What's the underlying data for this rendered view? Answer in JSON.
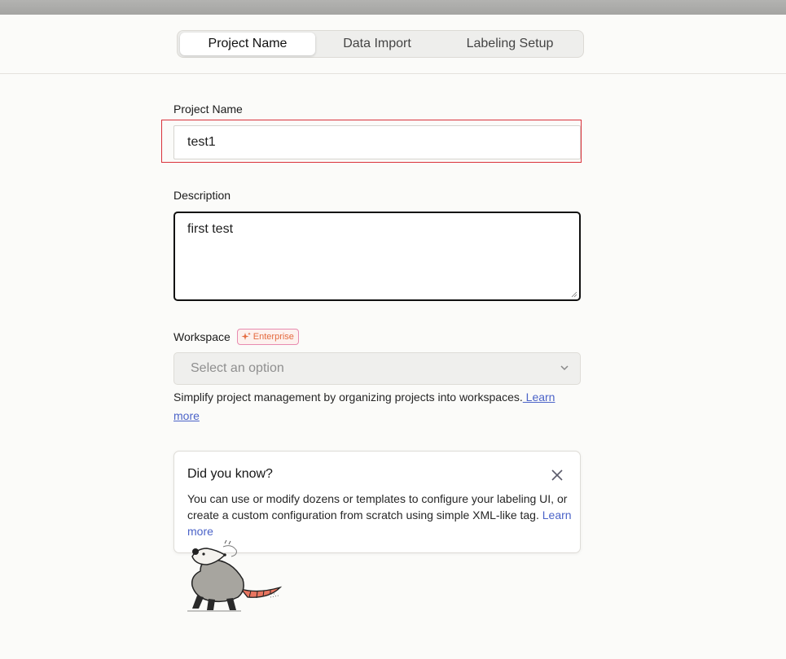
{
  "tabs": [
    {
      "label": "Project Name",
      "active": true
    },
    {
      "label": "Data Import",
      "active": false
    },
    {
      "label": "Labeling Setup",
      "active": false
    }
  ],
  "form": {
    "project_name_label": "Project Name",
    "project_name_value": "test1",
    "description_label": "Description",
    "description_value": "first test",
    "workspace_label": "Workspace",
    "enterprise_badge": "Enterprise",
    "workspace_placeholder": "Select an option",
    "workspace_help": "Simplify project management by organizing projects into workspaces.",
    "learn_more_link": " Learn more"
  },
  "tip": {
    "title": "Did you know?",
    "body": "You can use or modify dozens or templates to configure your labeling UI, or create a custom configuration from scratch using simple XML-like tag.",
    "link": "Learn more"
  },
  "colors": {
    "accent_link": "#4b63c8",
    "error_outline": "#d9313a",
    "enterprise_text": "#e46b3f",
    "page_bg": "#fbfbf9"
  },
  "icons": {
    "close": "close-icon",
    "chevron": "chevron-down-icon",
    "sparkle": "sparkle-icon",
    "mascot": "opossum-illustration"
  }
}
